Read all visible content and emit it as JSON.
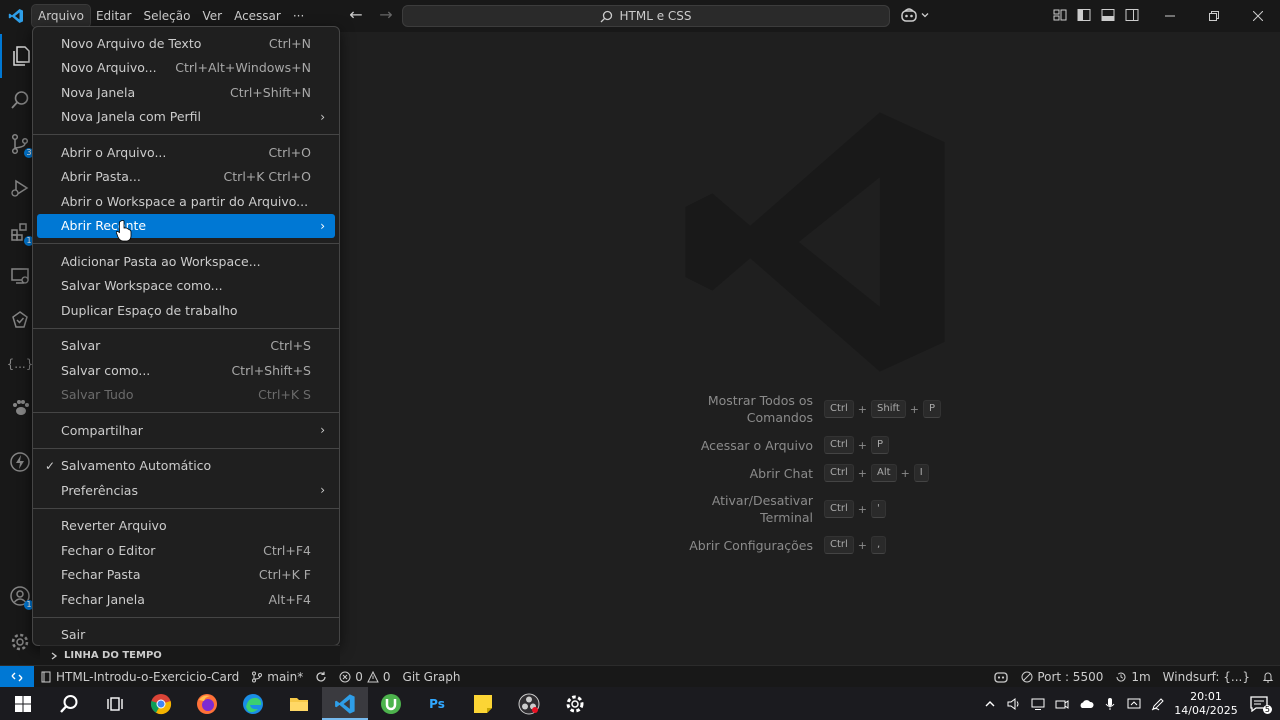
{
  "titlebar": {
    "menus": [
      "Arquivo",
      "Editar",
      "Seleção",
      "Ver",
      "Acessar",
      "···"
    ],
    "active_menu": 0,
    "command_center": "HTML e CSS"
  },
  "file_menu": {
    "items": [
      {
        "label": "Novo Arquivo de Texto",
        "kb": "Ctrl+N"
      },
      {
        "label": "Novo Arquivo...",
        "kb": "Ctrl+Alt+Windows+N"
      },
      {
        "label": "Nova Janela",
        "kb": "Ctrl+Shift+N"
      },
      {
        "label": "Nova Janela com Perfil",
        "kb": "",
        "submenu": true
      },
      {
        "sep": true
      },
      {
        "label": "Abrir o Arquivo...",
        "kb": "Ctrl+O"
      },
      {
        "label": "Abrir Pasta...",
        "kb": "Ctrl+K Ctrl+O"
      },
      {
        "label": "Abrir o Workspace a partir do Arquivo...",
        "kb": ""
      },
      {
        "label": "Abrir Recente",
        "kb": "",
        "submenu": true,
        "highlight": true
      },
      {
        "sep": true
      },
      {
        "label": "Adicionar Pasta ao Workspace...",
        "kb": ""
      },
      {
        "label": "Salvar Workspace como...",
        "kb": ""
      },
      {
        "label": "Duplicar Espaço de trabalho",
        "kb": ""
      },
      {
        "sep": true
      },
      {
        "label": "Salvar",
        "kb": "Ctrl+S"
      },
      {
        "label": "Salvar como...",
        "kb": "Ctrl+Shift+S"
      },
      {
        "label": "Salvar Tudo",
        "kb": "Ctrl+K S",
        "disabled": true
      },
      {
        "sep": true
      },
      {
        "label": "Compartilhar",
        "kb": "",
        "submenu": true
      },
      {
        "sep": true
      },
      {
        "label": "Salvamento Automático",
        "kb": "",
        "checked": true
      },
      {
        "label": "Preferências",
        "kb": "",
        "submenu": true
      },
      {
        "sep": true
      },
      {
        "label": "Reverter Arquivo",
        "kb": ""
      },
      {
        "label": "Fechar o Editor",
        "kb": "Ctrl+F4"
      },
      {
        "label": "Fechar Pasta",
        "kb": "Ctrl+K F"
      },
      {
        "label": "Fechar Janela",
        "kb": "Alt+F4"
      },
      {
        "sep": true
      },
      {
        "label": "Sair",
        "kb": ""
      }
    ]
  },
  "activity_badges": {
    "source_control": "3",
    "extensions": "1",
    "accounts": "1"
  },
  "activity_misc": {
    "json_icon_text": "{...}"
  },
  "shortcuts": [
    {
      "label": "Mostrar Todos os Comandos",
      "keys": [
        "Ctrl",
        "Shift",
        "P"
      ]
    },
    {
      "label": "Acessar o Arquivo",
      "keys": [
        "Ctrl",
        "P"
      ]
    },
    {
      "label": "Abrir Chat",
      "keys": [
        "Ctrl",
        "Alt",
        "I"
      ]
    },
    {
      "label": "Ativar/Desativar Terminal",
      "keys": [
        "Ctrl",
        "'"
      ]
    },
    {
      "label": "Abrir Configurações",
      "keys": [
        "Ctrl",
        ","
      ]
    }
  ],
  "timeline": {
    "label": "LINHA DO TEMPO"
  },
  "statusbar": {
    "repo": "HTML-Introdu-o-Exercicio-Card",
    "branch": "main*",
    "errors": "0",
    "warnings": "0",
    "git_graph": "Git Graph",
    "port": "Port : 5500",
    "time": "1m",
    "windsurf": "Windsurf: {...}"
  },
  "taskbar": {
    "clock_time": "20:01",
    "clock_date": "14/04/2025",
    "notifications": "5",
    "ps_label": "Ps"
  },
  "colors": {
    "accent": "#0078d4",
    "menu_bg": "#1f1f1f",
    "editor_bg": "#1f1f1f"
  }
}
